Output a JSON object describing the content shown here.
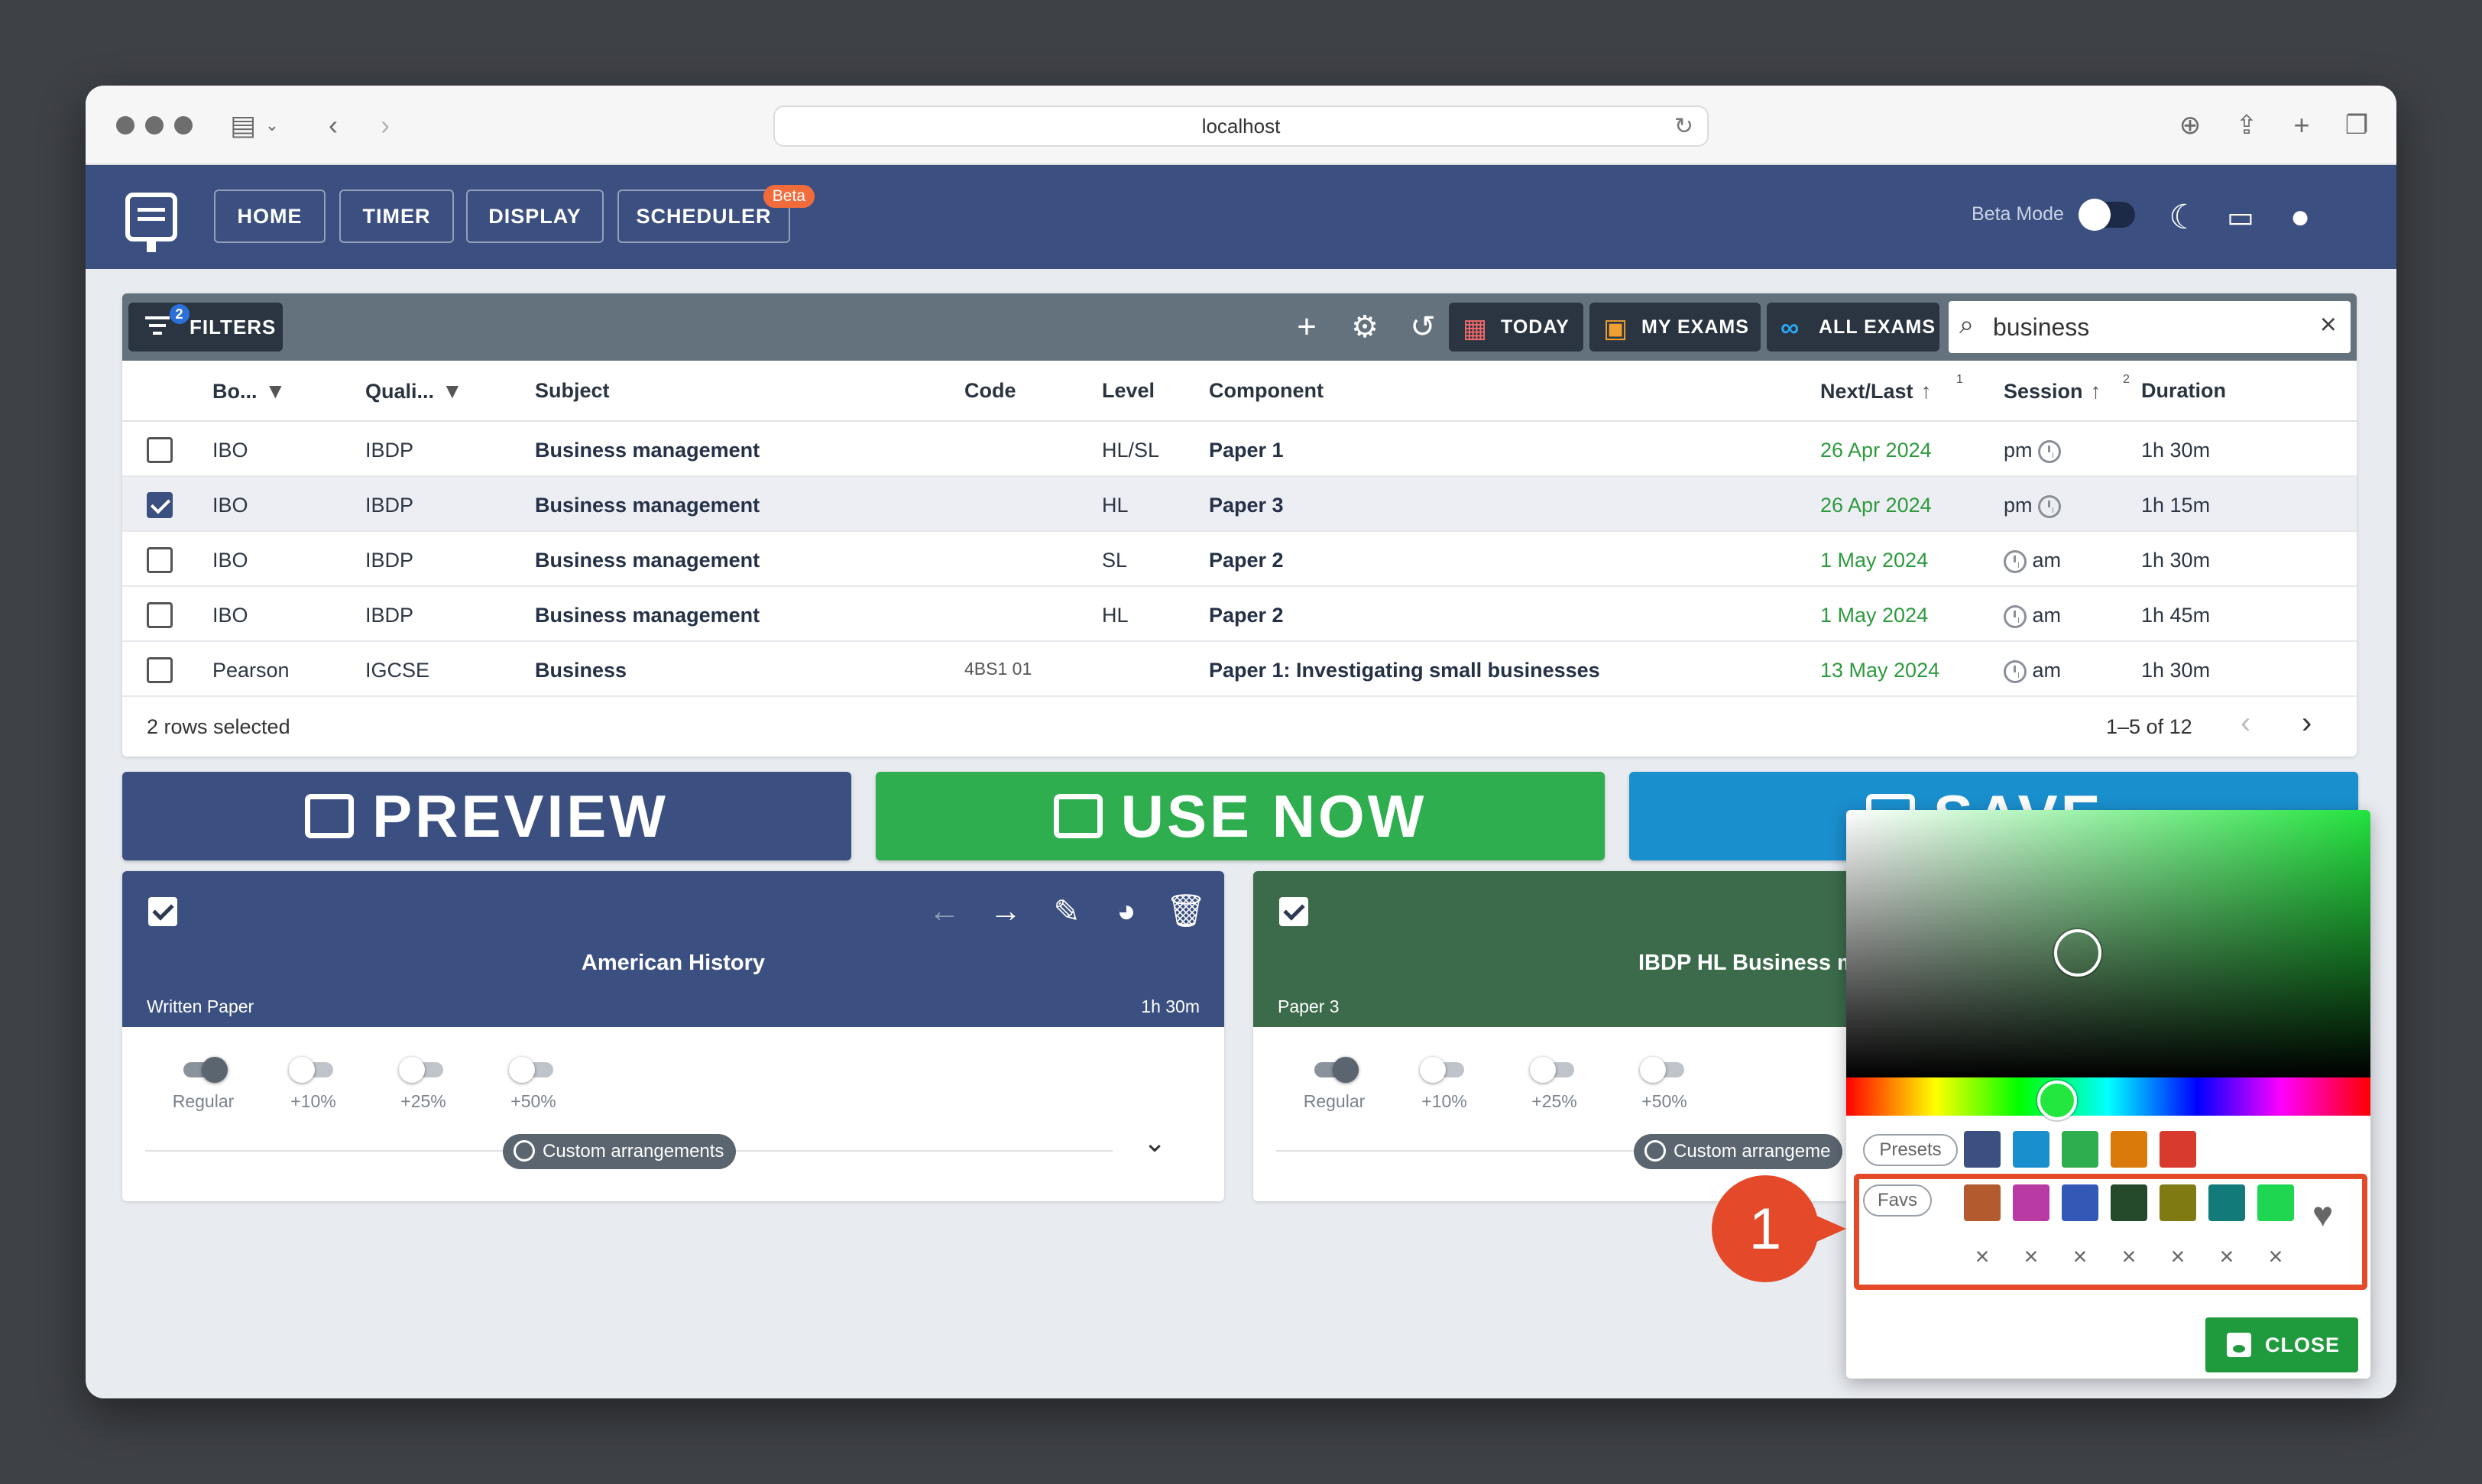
{
  "browser": {
    "url": "localhost"
  },
  "nav": {
    "home": "HOME",
    "timer": "TIMER",
    "display": "DISPLAY",
    "scheduler": "SCHEDULER",
    "scheduler_badge": "Beta",
    "beta_mode_label": "Beta Mode"
  },
  "toolbar": {
    "filters_label": "FILTERS",
    "filters_count": "2",
    "today": "TODAY",
    "my_exams": "MY EXAMS",
    "all_exams": "ALL EXAMS",
    "search_value": "business"
  },
  "table": {
    "columns": {
      "board": "Bo...",
      "qualification": "Quali...",
      "subject": "Subject",
      "code": "Code",
      "level": "Level",
      "component": "Component",
      "next_last": "Next/Last",
      "next_last_sort": "1",
      "session": "Session",
      "session_sort": "2",
      "duration": "Duration"
    },
    "rows": [
      {
        "selected": false,
        "board": "IBO",
        "qualification": "IBDP",
        "subject": "Business management",
        "code": "",
        "level": "HL/SL",
        "component": "Paper 1",
        "date": "26 Apr 2024",
        "session": "pm",
        "duration": "1h 30m"
      },
      {
        "selected": true,
        "board": "IBO",
        "qualification": "IBDP",
        "subject": "Business management",
        "code": "",
        "level": "HL",
        "component": "Paper 3",
        "date": "26 Apr 2024",
        "session": "pm",
        "duration": "1h 15m"
      },
      {
        "selected": false,
        "board": "IBO",
        "qualification": "IBDP",
        "subject": "Business management",
        "code": "",
        "level": "SL",
        "component": "Paper 2",
        "date": "1 May 2024",
        "session": "am",
        "duration": "1h 30m"
      },
      {
        "selected": false,
        "board": "IBO",
        "qualification": "IBDP",
        "subject": "Business management",
        "code": "",
        "level": "HL",
        "component": "Paper 2",
        "date": "1 May 2024",
        "session": "am",
        "duration": "1h 45m"
      },
      {
        "selected": false,
        "board": "Pearson",
        "qualification": "IGCSE",
        "subject": "Business",
        "code": "4BS1 01",
        "level": "",
        "component": "Paper 1: Investigating small businesses",
        "date": "13 May 2024",
        "session": "am",
        "duration": "1h 30m"
      }
    ],
    "footer_selected": "2 rows selected",
    "pagination": "1–5 of 12"
  },
  "actions": {
    "preview": "PREVIEW",
    "use_now": "USE NOW",
    "save": "SAVE"
  },
  "exam_cards": [
    {
      "title": "American History",
      "subtitle": "Written Paper",
      "duration": "1h 30m",
      "color": "#3b5080",
      "toggles": [
        "Regular",
        "+10%",
        "+25%",
        "+50%"
      ],
      "custom": "Custom arrangements"
    },
    {
      "title": "IBDP HL Business m",
      "subtitle": "Paper 3",
      "duration": "",
      "color": "#3b6b4b",
      "toggles": [
        "Regular",
        "+10%",
        "+25%",
        "+50%"
      ],
      "custom": "Custom arrangeme"
    }
  ],
  "picker": {
    "presets_label": "Presets",
    "favs_label": "Favs",
    "presets": [
      "#3b5080",
      "#1a8fce",
      "#2eae4e",
      "#d97a0a",
      "#d93a2e"
    ],
    "favs": [
      "#b35a2e",
      "#b93aa3",
      "#3458b5",
      "#24492b",
      "#7f7a12",
      "#137a7a",
      "#1fd650"
    ],
    "close": "CLOSE"
  },
  "callout": {
    "number": "1"
  }
}
